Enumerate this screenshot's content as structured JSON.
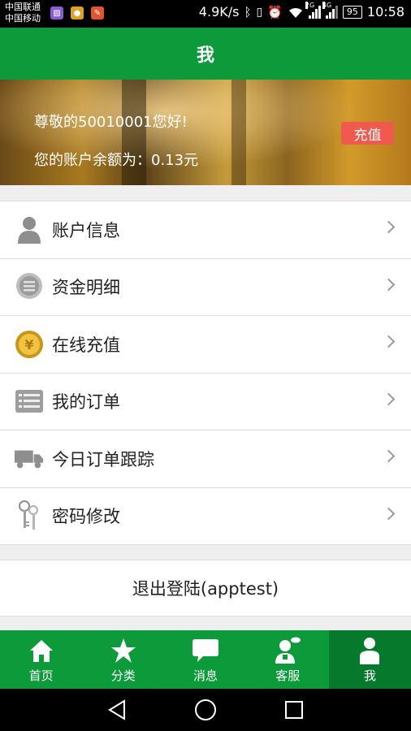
{
  "status_bar": {
    "carrier1": "中国联通",
    "carrier2": "中国移动",
    "speed": "4.9K/s",
    "net1": "2G",
    "net2": "4G",
    "battery": "95",
    "time": "10:58"
  },
  "header": {
    "title": "我"
  },
  "banner": {
    "greeting": "尊敬的50010001您好!",
    "balance": "您的账户余额为：0.13元",
    "recharge": "充值"
  },
  "menu": {
    "items": [
      {
        "label": "账户信息",
        "icon": "person-icon"
      },
      {
        "label": "资金明细",
        "icon": "document-bubble-icon"
      },
      {
        "label": "在线充值",
        "icon": "yen-coin-icon"
      },
      {
        "label": "我的订单",
        "icon": "list-icon"
      },
      {
        "label": "今日订单跟踪",
        "icon": "truck-icon"
      },
      {
        "label": "密码修改",
        "icon": "keys-icon"
      }
    ]
  },
  "logout": {
    "label": "退出登陆(apptest)"
  },
  "tabs": [
    {
      "label": "首页",
      "icon": "home-icon"
    },
    {
      "label": "分类",
      "icon": "star-icon"
    },
    {
      "label": "消息",
      "icon": "chat-icon"
    },
    {
      "label": "客服",
      "icon": "customer-service-icon"
    },
    {
      "label": "我",
      "icon": "person-icon",
      "active": true
    }
  ],
  "colors": {
    "primary": "#0c9a3b",
    "tab_active": "#07792c",
    "recharge": "#f05a4e"
  }
}
